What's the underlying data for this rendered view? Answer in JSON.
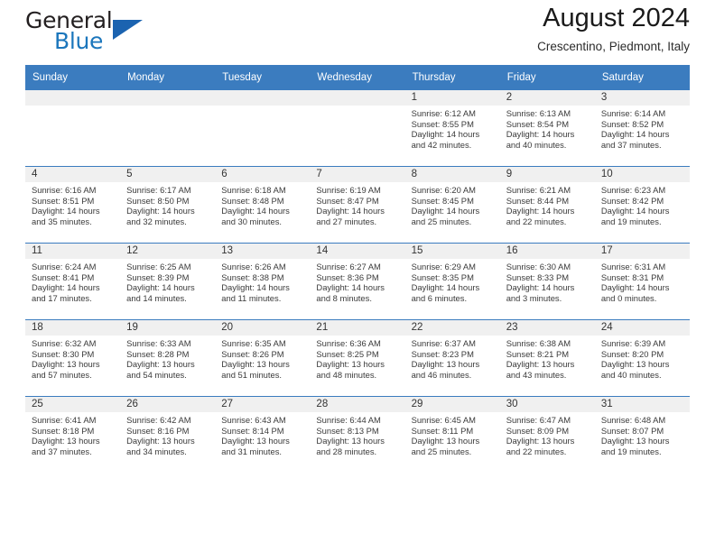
{
  "brand": {
    "name_part1": "General",
    "name_part2": "Blue",
    "triangle_icon": "brand-triangle-icon",
    "accent_color": "#1b76bc"
  },
  "header": {
    "title": "August 2024",
    "location": "Crescentino, Piedmont, Italy"
  },
  "calendar": {
    "header_bg": "#3b7cbf",
    "daynum_bg": "#f0f0f0",
    "weekdays": [
      "Sunday",
      "Monday",
      "Tuesday",
      "Wednesday",
      "Thursday",
      "Friday",
      "Saturday"
    ],
    "weeks": [
      [
        {
          "day": "",
          "sunrise": "",
          "sunset": "",
          "daylight1": "",
          "daylight2": ""
        },
        {
          "day": "",
          "sunrise": "",
          "sunset": "",
          "daylight1": "",
          "daylight2": ""
        },
        {
          "day": "",
          "sunrise": "",
          "sunset": "",
          "daylight1": "",
          "daylight2": ""
        },
        {
          "day": "",
          "sunrise": "",
          "sunset": "",
          "daylight1": "",
          "daylight2": ""
        },
        {
          "day": "1",
          "sunrise": "Sunrise: 6:12 AM",
          "sunset": "Sunset: 8:55 PM",
          "daylight1": "Daylight: 14 hours",
          "daylight2": "and 42 minutes."
        },
        {
          "day": "2",
          "sunrise": "Sunrise: 6:13 AM",
          "sunset": "Sunset: 8:54 PM",
          "daylight1": "Daylight: 14 hours",
          "daylight2": "and 40 minutes."
        },
        {
          "day": "3",
          "sunrise": "Sunrise: 6:14 AM",
          "sunset": "Sunset: 8:52 PM",
          "daylight1": "Daylight: 14 hours",
          "daylight2": "and 37 minutes."
        }
      ],
      [
        {
          "day": "4",
          "sunrise": "Sunrise: 6:16 AM",
          "sunset": "Sunset: 8:51 PM",
          "daylight1": "Daylight: 14 hours",
          "daylight2": "and 35 minutes."
        },
        {
          "day": "5",
          "sunrise": "Sunrise: 6:17 AM",
          "sunset": "Sunset: 8:50 PM",
          "daylight1": "Daylight: 14 hours",
          "daylight2": "and 32 minutes."
        },
        {
          "day": "6",
          "sunrise": "Sunrise: 6:18 AM",
          "sunset": "Sunset: 8:48 PM",
          "daylight1": "Daylight: 14 hours",
          "daylight2": "and 30 minutes."
        },
        {
          "day": "7",
          "sunrise": "Sunrise: 6:19 AM",
          "sunset": "Sunset: 8:47 PM",
          "daylight1": "Daylight: 14 hours",
          "daylight2": "and 27 minutes."
        },
        {
          "day": "8",
          "sunrise": "Sunrise: 6:20 AM",
          "sunset": "Sunset: 8:45 PM",
          "daylight1": "Daylight: 14 hours",
          "daylight2": "and 25 minutes."
        },
        {
          "day": "9",
          "sunrise": "Sunrise: 6:21 AM",
          "sunset": "Sunset: 8:44 PM",
          "daylight1": "Daylight: 14 hours",
          "daylight2": "and 22 minutes."
        },
        {
          "day": "10",
          "sunrise": "Sunrise: 6:23 AM",
          "sunset": "Sunset: 8:42 PM",
          "daylight1": "Daylight: 14 hours",
          "daylight2": "and 19 minutes."
        }
      ],
      [
        {
          "day": "11",
          "sunrise": "Sunrise: 6:24 AM",
          "sunset": "Sunset: 8:41 PM",
          "daylight1": "Daylight: 14 hours",
          "daylight2": "and 17 minutes."
        },
        {
          "day": "12",
          "sunrise": "Sunrise: 6:25 AM",
          "sunset": "Sunset: 8:39 PM",
          "daylight1": "Daylight: 14 hours",
          "daylight2": "and 14 minutes."
        },
        {
          "day": "13",
          "sunrise": "Sunrise: 6:26 AM",
          "sunset": "Sunset: 8:38 PM",
          "daylight1": "Daylight: 14 hours",
          "daylight2": "and 11 minutes."
        },
        {
          "day": "14",
          "sunrise": "Sunrise: 6:27 AM",
          "sunset": "Sunset: 8:36 PM",
          "daylight1": "Daylight: 14 hours",
          "daylight2": "and 8 minutes."
        },
        {
          "day": "15",
          "sunrise": "Sunrise: 6:29 AM",
          "sunset": "Sunset: 8:35 PM",
          "daylight1": "Daylight: 14 hours",
          "daylight2": "and 6 minutes."
        },
        {
          "day": "16",
          "sunrise": "Sunrise: 6:30 AM",
          "sunset": "Sunset: 8:33 PM",
          "daylight1": "Daylight: 14 hours",
          "daylight2": "and 3 minutes."
        },
        {
          "day": "17",
          "sunrise": "Sunrise: 6:31 AM",
          "sunset": "Sunset: 8:31 PM",
          "daylight1": "Daylight: 14 hours",
          "daylight2": "and 0 minutes."
        }
      ],
      [
        {
          "day": "18",
          "sunrise": "Sunrise: 6:32 AM",
          "sunset": "Sunset: 8:30 PM",
          "daylight1": "Daylight: 13 hours",
          "daylight2": "and 57 minutes."
        },
        {
          "day": "19",
          "sunrise": "Sunrise: 6:33 AM",
          "sunset": "Sunset: 8:28 PM",
          "daylight1": "Daylight: 13 hours",
          "daylight2": "and 54 minutes."
        },
        {
          "day": "20",
          "sunrise": "Sunrise: 6:35 AM",
          "sunset": "Sunset: 8:26 PM",
          "daylight1": "Daylight: 13 hours",
          "daylight2": "and 51 minutes."
        },
        {
          "day": "21",
          "sunrise": "Sunrise: 6:36 AM",
          "sunset": "Sunset: 8:25 PM",
          "daylight1": "Daylight: 13 hours",
          "daylight2": "and 48 minutes."
        },
        {
          "day": "22",
          "sunrise": "Sunrise: 6:37 AM",
          "sunset": "Sunset: 8:23 PM",
          "daylight1": "Daylight: 13 hours",
          "daylight2": "and 46 minutes."
        },
        {
          "day": "23",
          "sunrise": "Sunrise: 6:38 AM",
          "sunset": "Sunset: 8:21 PM",
          "daylight1": "Daylight: 13 hours",
          "daylight2": "and 43 minutes."
        },
        {
          "day": "24",
          "sunrise": "Sunrise: 6:39 AM",
          "sunset": "Sunset: 8:20 PM",
          "daylight1": "Daylight: 13 hours",
          "daylight2": "and 40 minutes."
        }
      ],
      [
        {
          "day": "25",
          "sunrise": "Sunrise: 6:41 AM",
          "sunset": "Sunset: 8:18 PM",
          "daylight1": "Daylight: 13 hours",
          "daylight2": "and 37 minutes."
        },
        {
          "day": "26",
          "sunrise": "Sunrise: 6:42 AM",
          "sunset": "Sunset: 8:16 PM",
          "daylight1": "Daylight: 13 hours",
          "daylight2": "and 34 minutes."
        },
        {
          "day": "27",
          "sunrise": "Sunrise: 6:43 AM",
          "sunset": "Sunset: 8:14 PM",
          "daylight1": "Daylight: 13 hours",
          "daylight2": "and 31 minutes."
        },
        {
          "day": "28",
          "sunrise": "Sunrise: 6:44 AM",
          "sunset": "Sunset: 8:13 PM",
          "daylight1": "Daylight: 13 hours",
          "daylight2": "and 28 minutes."
        },
        {
          "day": "29",
          "sunrise": "Sunrise: 6:45 AM",
          "sunset": "Sunset: 8:11 PM",
          "daylight1": "Daylight: 13 hours",
          "daylight2": "and 25 minutes."
        },
        {
          "day": "30",
          "sunrise": "Sunrise: 6:47 AM",
          "sunset": "Sunset: 8:09 PM",
          "daylight1": "Daylight: 13 hours",
          "daylight2": "and 22 minutes."
        },
        {
          "day": "31",
          "sunrise": "Sunrise: 6:48 AM",
          "sunset": "Sunset: 8:07 PM",
          "daylight1": "Daylight: 13 hours",
          "daylight2": "and 19 minutes."
        }
      ]
    ]
  }
}
